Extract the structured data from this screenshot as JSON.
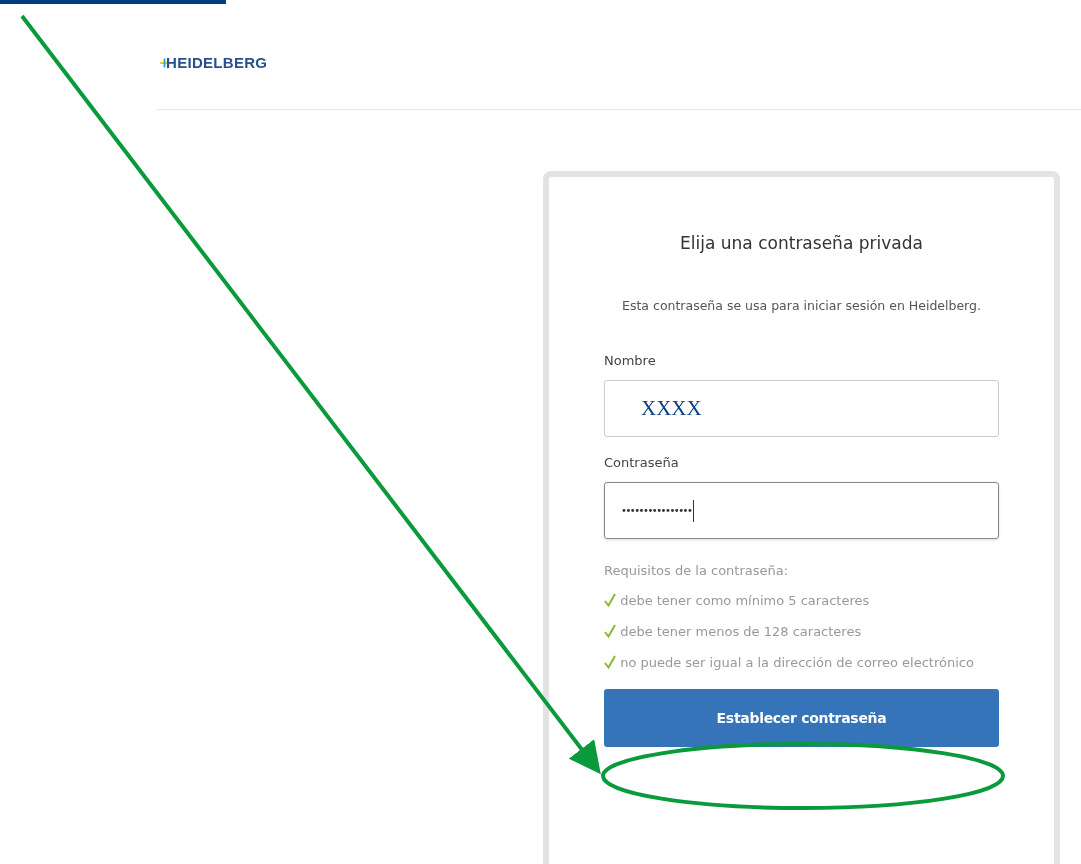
{
  "header": {
    "logo": "HEIDELBERG"
  },
  "card": {
    "title": "Elija una contraseña privada",
    "description": "Esta contraseña se usa para iniciar sesión en Heidelberg.",
    "fields": [
      {
        "label": "Nombre",
        "value": "XXXX",
        "kind": "text"
      },
      {
        "label": "Contraseña",
        "value": "••••••••••••••••",
        "kind": "password"
      }
    ],
    "requirements_title": "Requisitos de la contraseña:",
    "requirements": [
      {
        "text": "debe tener como mínimo 5 caracteres",
        "met": true
      },
      {
        "text": "debe tener menos de 128 caracteres",
        "met": true
      },
      {
        "text": "no puede ser igual a la dirección de correo electrónico",
        "met": true
      }
    ],
    "submit": "Establecer contraseña"
  }
}
